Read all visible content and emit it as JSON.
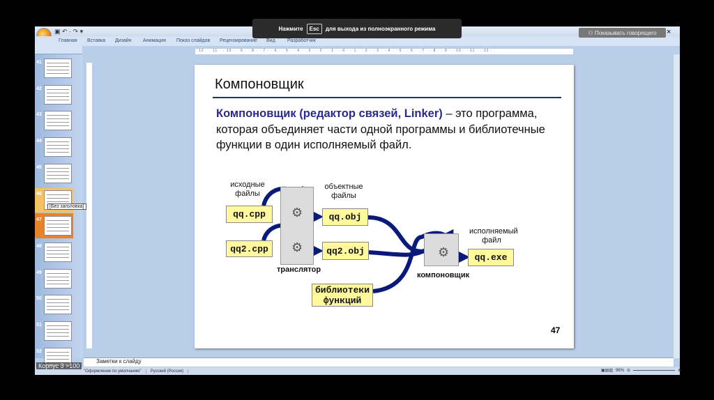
{
  "toast": {
    "before": "Нажмите",
    "key": "Esc",
    "after": "для выхода из полноэкранного режима"
  },
  "speaker_button": "Показывать говорящего",
  "close": "×",
  "qat": "▣ ↶ · ↷ ▾",
  "tabs": [
    "Главная",
    "Вставка",
    "Дизайн",
    "Анимация",
    "Показ слайдов",
    "Рецензирование",
    "Вид",
    "Разработчик"
  ],
  "ruler": "· 12 · · 11 · · 10 · · 9 · · 8 · · 7 · · 6 · · 5 · · 4 · · 3 · · 2 · · 1 · · 0 · · 1 · · 2 · · 3 · · 4 · · 5 · · 6 · · 7 · · 8 · · 9 · · 10 · · 11 · · 12 ·",
  "thumbnails": [
    "41",
    "42",
    "43",
    "44",
    "45",
    "46",
    "47",
    "48",
    "49",
    "50",
    "51",
    "52"
  ],
  "tooltip": "[Без заголовка]",
  "slide": {
    "title": "Компоновщик",
    "para_highlight": "Компоновщик (редактор связей, Linker)",
    "para_rest": " – это программа, которая объединяет части одной программы и библиотечные функции в один исполняемый файл.",
    "page_number": "47",
    "diagram": {
      "source_label": "исходные файлы",
      "object_label": "объектные файлы",
      "exe_label": "исполняемый файл",
      "translator": "транслятор",
      "linker": "компоновщик",
      "src1": "qq.cpp",
      "src2": "qq2.cpp",
      "obj1": "qq.obj",
      "obj2": "qq2.obj",
      "exe": "qq.exe",
      "libs": "библиотеки функций"
    }
  },
  "notes_placeholder": "Заметки к слайду",
  "status": {
    "corpus": "Корпус 3 >100",
    "theme": "\"Оформление по умолчанию\"",
    "language": "Русский (Россия)",
    "zoom": "96%"
  }
}
